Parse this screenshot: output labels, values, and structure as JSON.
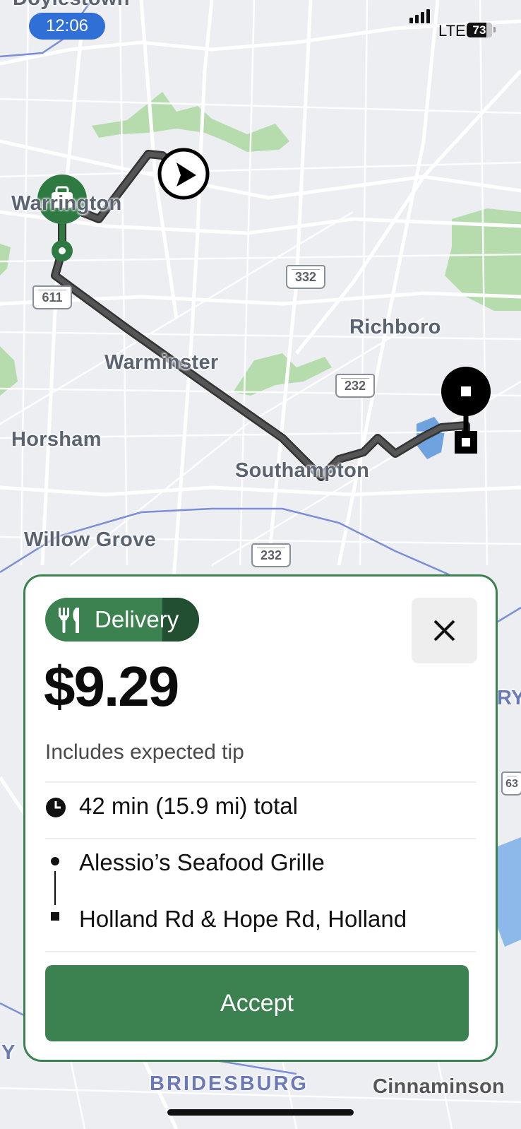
{
  "status_bar": {
    "time": "12:06",
    "network": "LTE",
    "battery": "73"
  },
  "map": {
    "towns": [
      "Doylestown",
      "Warrington",
      "Richboro",
      "Warminster",
      "Horsham",
      "Southampton",
      "Willow Grove",
      "BRIDESBURG",
      "Cinnaminson",
      "RY",
      "Y"
    ],
    "route_shields": [
      "332",
      "611",
      "232",
      "232",
      "63"
    ]
  },
  "offer": {
    "type_label": "Delivery",
    "price": "$9.29",
    "tip_note": "Includes expected tip",
    "duration": "42 min (15.9 mi) total",
    "pickup": "Alessio’s Seafood Grille",
    "dropoff": "Holland Rd & Hope Rd, Holland",
    "accept_label": "Accept"
  },
  "colors": {
    "accent": "#3b8250",
    "accent_dark": "#224f31",
    "status_pill": "#2f6fd6"
  },
  "icons": [
    "utensils-icon",
    "close-icon",
    "clock-icon",
    "pickup-dot-icon",
    "dropoff-square-icon",
    "navigation-arrow-icon",
    "bag-icon"
  ]
}
